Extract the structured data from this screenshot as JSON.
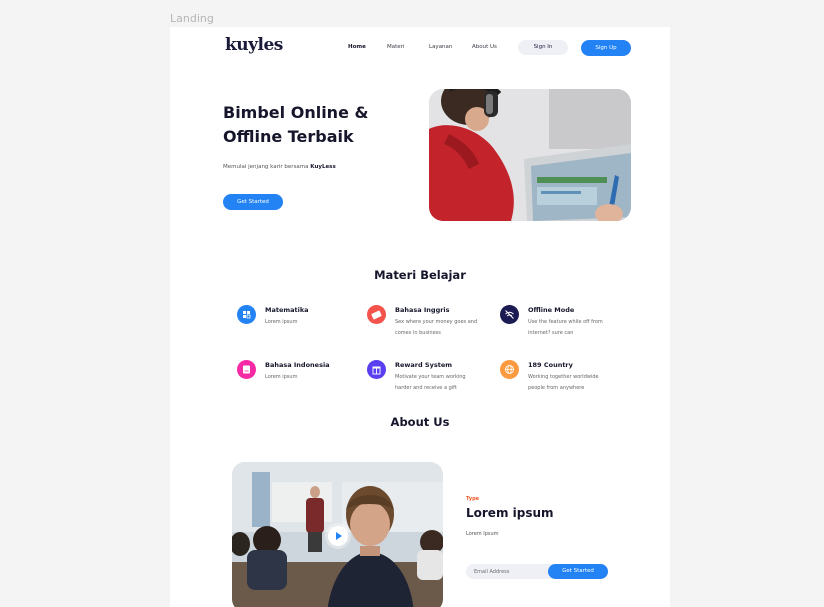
{
  "frame": {
    "label": "Landing"
  },
  "nav": {
    "logo": "kuyles",
    "links": [
      "Home",
      "Materi",
      "Layanan",
      "About Us"
    ],
    "signin": "Sign In",
    "signup": "Sign Up"
  },
  "hero": {
    "title": "Bimbel Online & Offline Terbaik",
    "subtitle_prefix": "Memulai jenjang karir bersama ",
    "subtitle_brand": "KuyLess",
    "cta": "Get Started"
  },
  "materi": {
    "title": "Materi Belajar",
    "items": [
      {
        "title": "Matematika",
        "desc": "Lorem ipsum",
        "icon": "qr-grid-icon",
        "color": "#2383f4"
      },
      {
        "title": "Bahasa Inggris",
        "desc": "Sex where your money goes and comes in business",
        "icon": "ticket-icon",
        "color": "#f3534a"
      },
      {
        "title": "Offline Mode",
        "desc": "Use the feature while off from internet? sure can",
        "icon": "no-wifi-icon",
        "color": "#1b1a52"
      },
      {
        "title": "Bahasa Indonesia",
        "desc": "Lorem ipsum",
        "icon": "book-icon",
        "color": "#f72aa5"
      },
      {
        "title": "Reward System",
        "desc": "Motivate your team working harder and receive a gift",
        "icon": "gift-icon",
        "color": "#5a3ff0"
      },
      {
        "title": "189 Country",
        "desc": "Working together worldwide people from anywhere",
        "icon": "globe-icon",
        "color": "#fb9a3e"
      }
    ]
  },
  "about": {
    "title": "About Us",
    "type_label": "Type",
    "heading": "Lorem ipsum",
    "text": "Lorem Ipsum",
    "email_placeholder": "Email Address",
    "cta": "Get Started"
  }
}
